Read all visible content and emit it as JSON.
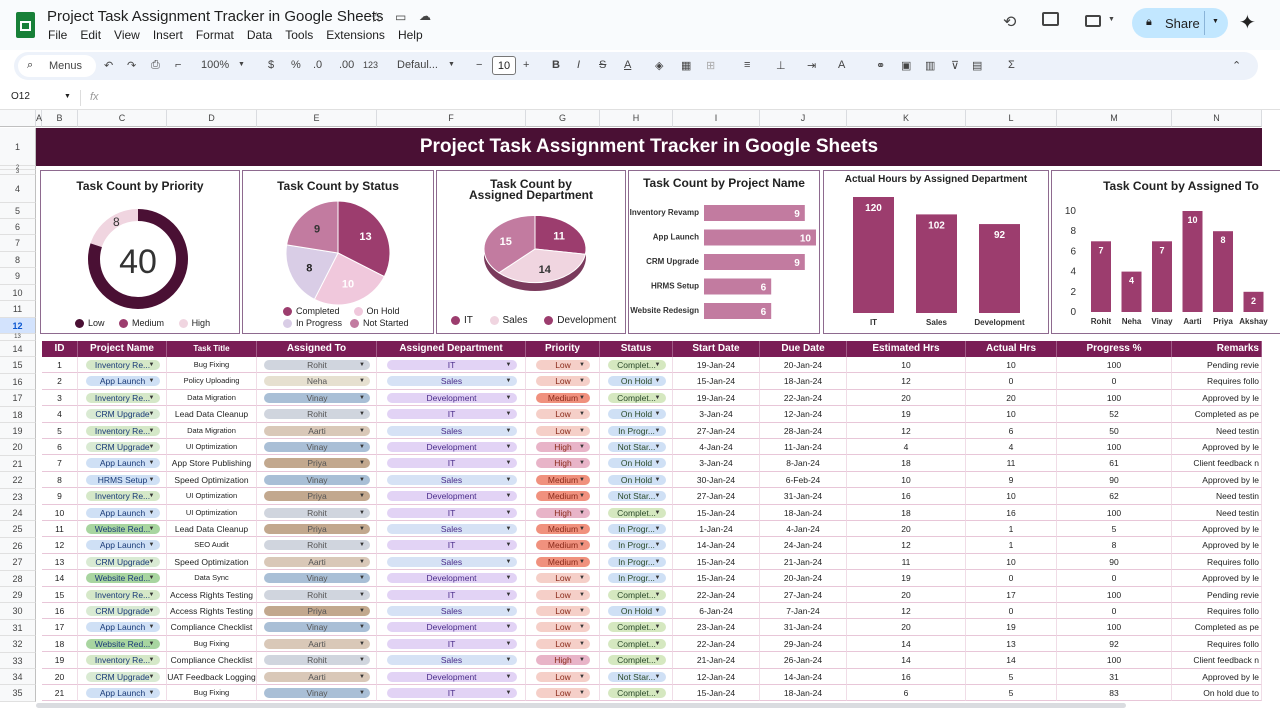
{
  "app": {
    "title": "Project Task Assignment Tracker in Google Sheets",
    "menus": [
      "File",
      "Edit",
      "View",
      "Insert",
      "Format",
      "Data",
      "Tools",
      "Extensions",
      "Help"
    ],
    "share_label": "Share",
    "menus_search": "Menus",
    "zoom": "100%",
    "font": "Defaul...",
    "font_size": "10",
    "cell_ref": "O12",
    "fx": "fx",
    "currency": "$",
    "percent": "%",
    "dec_minus": ".0",
    "dec_plus": ".00",
    "num_format": "123"
  },
  "sheet": {
    "column_letters": [
      "A",
      "B",
      "C",
      "D",
      "E",
      "F",
      "G",
      "H",
      "I",
      "J",
      "K",
      "L",
      "M",
      "N"
    ],
    "row_numbers": [
      "1",
      "2",
      "3",
      "4",
      "5",
      "6",
      "7",
      "8",
      "9",
      "10",
      "11",
      "12",
      "13",
      "14",
      "15",
      "16",
      "17",
      "18",
      "19",
      "20",
      "21",
      "22",
      "23",
      "24",
      "25",
      "26",
      "27",
      "28",
      "29",
      "30",
      "31",
      "32",
      "33",
      "34",
      "35"
    ],
    "banner": "Project Task Assignment Tracker in Google Sheets"
  },
  "charts": {
    "priority": {
      "title": "Task Count by Priority",
      "center": "40",
      "labels": [
        "Low",
        "Medium",
        "High"
      ],
      "values": [
        8,
        0,
        32
      ],
      "display": [
        "8"
      ],
      "colors": [
        "#4a1034",
        "#9c3d6e",
        "#f0d5e0"
      ]
    },
    "status": {
      "title": "Task Count by Status",
      "labels": [
        "Completed",
        "On Hold",
        "In Progress",
        "Not Started"
      ],
      "values": [
        13,
        10,
        8,
        9
      ],
      "colors": [
        "#9c3d6e",
        "#f0c8dc",
        "#d9cde6",
        "#c27ba0"
      ]
    },
    "department": {
      "title": "Task Count by Assigned Department",
      "labels": [
        "IT",
        "Sales",
        "Development"
      ],
      "values": [
        11,
        14,
        15
      ],
      "colors": [
        "#9c3d6e",
        "#f0d5e0",
        "#c27ba0"
      ]
    },
    "project": {
      "title": "Task Count by Project Name",
      "categories": [
        "Inventory Revamp",
        "App Launch",
        "CRM Upgrade",
        "HRMS Setup",
        "Website Redesign"
      ],
      "values": [
        9,
        10,
        9,
        6,
        6
      ]
    },
    "hours": {
      "title": "Actual Hours by Assigned Department",
      "categories": [
        "IT",
        "Sales",
        "Development"
      ],
      "values": [
        120,
        102,
        92
      ]
    },
    "assignee": {
      "title": "Task Count by Assigned To",
      "categories": [
        "Rohit",
        "Neha",
        "Vinay",
        "Aarti",
        "Priya",
        "Akshay"
      ],
      "values": [
        7,
        4,
        7,
        10,
        8,
        2
      ],
      "yticks": [
        "10",
        "8",
        "6",
        "4",
        "2",
        "0"
      ]
    }
  },
  "chart_data": [
    {
      "type": "pie",
      "title": "Task Count by Priority",
      "labels": [
        "Low",
        "Medium",
        "High"
      ],
      "values": [
        8,
        0,
        32
      ]
    },
    {
      "type": "pie",
      "title": "Task Count by Status",
      "labels": [
        "Completed",
        "On Hold",
        "In Progress",
        "Not Started"
      ],
      "values": [
        13,
        10,
        8,
        9
      ]
    },
    {
      "type": "pie",
      "title": "Task Count by Assigned Department",
      "labels": [
        "IT",
        "Sales",
        "Development"
      ],
      "values": [
        11,
        14,
        15
      ]
    },
    {
      "type": "bar",
      "title": "Task Count by Project Name",
      "categories": [
        "Inventory Revamp",
        "App Launch",
        "CRM Upgrade",
        "HRMS Setup",
        "Website Redesign"
      ],
      "values": [
        9,
        10,
        9,
        6,
        6
      ]
    },
    {
      "type": "bar",
      "title": "Actual Hours by Assigned Department",
      "categories": [
        "IT",
        "Sales",
        "Development"
      ],
      "values": [
        120,
        102,
        92
      ]
    },
    {
      "type": "bar",
      "title": "Task Count by Assigned To",
      "categories": [
        "Rohit",
        "Neha",
        "Vinay",
        "Aarti",
        "Priya",
        "Akshay"
      ],
      "values": [
        7,
        4,
        7,
        10,
        8,
        2
      ],
      "ylim": [
        0,
        10
      ]
    }
  ],
  "table": {
    "headers": [
      "ID",
      "Project Name",
      "Task Title",
      "Assigned To",
      "Assigned Department",
      "Priority",
      "Status",
      "Start Date",
      "Due Date",
      "Estimated Hrs",
      "Actual Hrs",
      "Progress %",
      "Remarks"
    ],
    "rows": [
      [
        "1",
        "Inventory Re...",
        "Bug Fixing",
        "Rohit",
        "IT",
        "Low",
        "Complet...",
        "19-Jan-24",
        "20-Jan-24",
        "10",
        "10",
        "100",
        "Pending revie"
      ],
      [
        "2",
        "App Launch",
        "Policy Uploading",
        "Neha",
        "Sales",
        "Low",
        "On Hold",
        "15-Jan-24",
        "18-Jan-24",
        "12",
        "0",
        "0",
        "Requires follo"
      ],
      [
        "3",
        "Inventory Re...",
        "Data Migration",
        "Vinay",
        "Development",
        "Medium",
        "Complet...",
        "19-Jan-24",
        "22-Jan-24",
        "20",
        "20",
        "100",
        "Approved by le"
      ],
      [
        "4",
        "CRM Upgrade",
        "Lead Data Cleanup",
        "Rohit",
        "IT",
        "Low",
        "On Hold",
        "3-Jan-24",
        "12-Jan-24",
        "19",
        "10",
        "52",
        "Completed as pe"
      ],
      [
        "5",
        "Inventory Re...",
        "Data Migration",
        "Aarti",
        "Sales",
        "Low",
        "In Progr...",
        "27-Jan-24",
        "28-Jan-24",
        "12",
        "6",
        "50",
        "Need testin"
      ],
      [
        "6",
        "CRM Upgrade",
        "UI Optimization",
        "Vinay",
        "Development",
        "High",
        "Not Star...",
        "4-Jan-24",
        "11-Jan-24",
        "4",
        "4",
        "100",
        "Approved by le"
      ],
      [
        "7",
        "App Launch",
        "App Store Publishing",
        "Priya",
        "IT",
        "High",
        "On Hold",
        "3-Jan-24",
        "8-Jan-24",
        "18",
        "11",
        "61",
        "Client feedback n"
      ],
      [
        "8",
        "HRMS Setup",
        "Speed Optimization",
        "Vinay",
        "Sales",
        "Medium",
        "On Hold",
        "30-Jan-24",
        "6-Feb-24",
        "10",
        "9",
        "90",
        "Approved by le"
      ],
      [
        "9",
        "Inventory Re...",
        "UI Optimization",
        "Priya",
        "Development",
        "Medium",
        "Not Star...",
        "27-Jan-24",
        "31-Jan-24",
        "16",
        "10",
        "62",
        "Need testin"
      ],
      [
        "10",
        "App Launch",
        "UI Optimization",
        "Rohit",
        "IT",
        "High",
        "Complet...",
        "15-Jan-24",
        "18-Jan-24",
        "18",
        "16",
        "100",
        "Need testin"
      ],
      [
        "11",
        "Website Red...",
        "Lead Data Cleanup",
        "Priya",
        "Sales",
        "Medium",
        "In Progr...",
        "1-Jan-24",
        "4-Jan-24",
        "20",
        "1",
        "5",
        "Approved by le"
      ],
      [
        "12",
        "App Launch",
        "SEO Audit",
        "Rohit",
        "IT",
        "Medium",
        "In Progr...",
        "14-Jan-24",
        "24-Jan-24",
        "12",
        "1",
        "8",
        "Approved by le"
      ],
      [
        "13",
        "CRM Upgrade",
        "Speed Optimization",
        "Aarti",
        "Sales",
        "Medium",
        "In Progr...",
        "15-Jan-24",
        "21-Jan-24",
        "11",
        "10",
        "90",
        "Requires follo"
      ],
      [
        "14",
        "Website Red...",
        "Data Sync",
        "Vinay",
        "Development",
        "Low",
        "In Progr...",
        "15-Jan-24",
        "20-Jan-24",
        "19",
        "0",
        "0",
        "Approved by le"
      ],
      [
        "15",
        "Inventory Re...",
        "Access Rights Testing",
        "Rohit",
        "IT",
        "Low",
        "Complet...",
        "22-Jan-24",
        "27-Jan-24",
        "20",
        "17",
        "100",
        "Pending revie"
      ],
      [
        "16",
        "CRM Upgrade",
        "Access Rights Testing",
        "Priya",
        "Sales",
        "Low",
        "On Hold",
        "6-Jan-24",
        "7-Jan-24",
        "12",
        "0",
        "0",
        "Requires follo"
      ],
      [
        "17",
        "App Launch",
        "Compliance Checklist",
        "Vinay",
        "Development",
        "Low",
        "Complet...",
        "23-Jan-24",
        "31-Jan-24",
        "20",
        "19",
        "100",
        "Completed as pe"
      ],
      [
        "18",
        "Website Red...",
        "Bug Fixing",
        "Aarti",
        "IT",
        "Low",
        "Complet...",
        "22-Jan-24",
        "29-Jan-24",
        "14",
        "13",
        "92",
        "Requires follo"
      ],
      [
        "19",
        "Inventory Re...",
        "Compliance Checklist",
        "Rohit",
        "Sales",
        "High",
        "Complet...",
        "21-Jan-24",
        "26-Jan-24",
        "14",
        "14",
        "100",
        "Client feedback n"
      ],
      [
        "20",
        "CRM Upgrade",
        "UAT Feedback Logging",
        "Aarti",
        "Development",
        "Low",
        "Not Star...",
        "12-Jan-24",
        "14-Jan-24",
        "16",
        "5",
        "31",
        "Approved by le"
      ],
      [
        "21",
        "App Launch",
        "Bug Fixing",
        "Vinay",
        "IT",
        "Low",
        "Complet...",
        "15-Jan-24",
        "18-Jan-24",
        "6",
        "5",
        "83",
        "On hold due to"
      ]
    ]
  },
  "colors": {
    "accent": "#7a1d55",
    "banner": "#4a1034",
    "bar": "#9c3d6e",
    "bar_light": "#c27ba0"
  }
}
